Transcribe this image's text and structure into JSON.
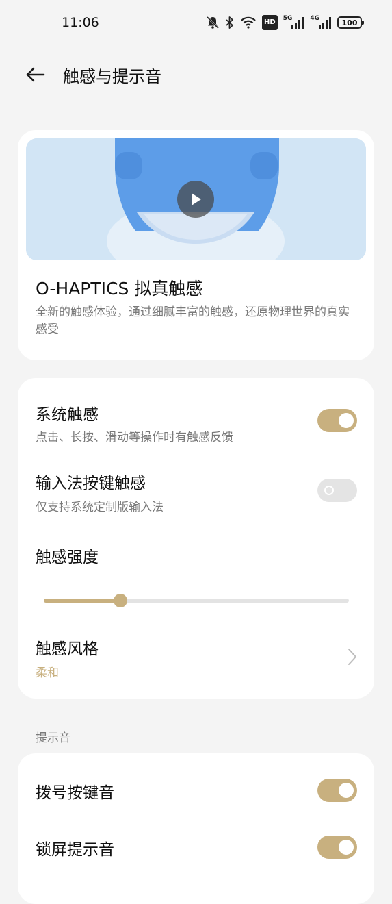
{
  "status_bar": {
    "time": "11:06",
    "icons": [
      "mute-bell-icon",
      "bluetooth-icon",
      "wifi-icon",
      "hd-icon",
      "signal-5g-icon",
      "signal-4g-icon",
      "battery-icon"
    ],
    "hd_label": "HD",
    "net1": "5G",
    "net2": "4G",
    "battery": "100"
  },
  "header": {
    "title": "触感与提示音",
    "back_icon": "arrow-left-icon"
  },
  "feature": {
    "title": "O-HAPTICS 拟真触感",
    "description": "全新的触感体验，通过细腻丰富的触感，还原物理世界的真实感受",
    "play_icon": "play-icon"
  },
  "haptics": {
    "system": {
      "title": "系统触感",
      "subtitle": "点击、长按、滑动等操作时有触感反馈",
      "enabled": true
    },
    "keyboard": {
      "title": "输入法按键触感",
      "subtitle": "仅支持系统定制版输入法",
      "enabled": false
    },
    "intensity": {
      "title": "触感强度",
      "value": 0.25
    },
    "style": {
      "title": "触感风格",
      "value": "柔和"
    }
  },
  "sounds": {
    "section_label": "提示音",
    "dial": {
      "title": "拨号按键音",
      "enabled": true
    },
    "lock": {
      "title": "锁屏提示音",
      "enabled": true
    }
  },
  "colors": {
    "accent": "#c8b07f",
    "background": "#f4f4f4",
    "card": "#ffffff"
  }
}
